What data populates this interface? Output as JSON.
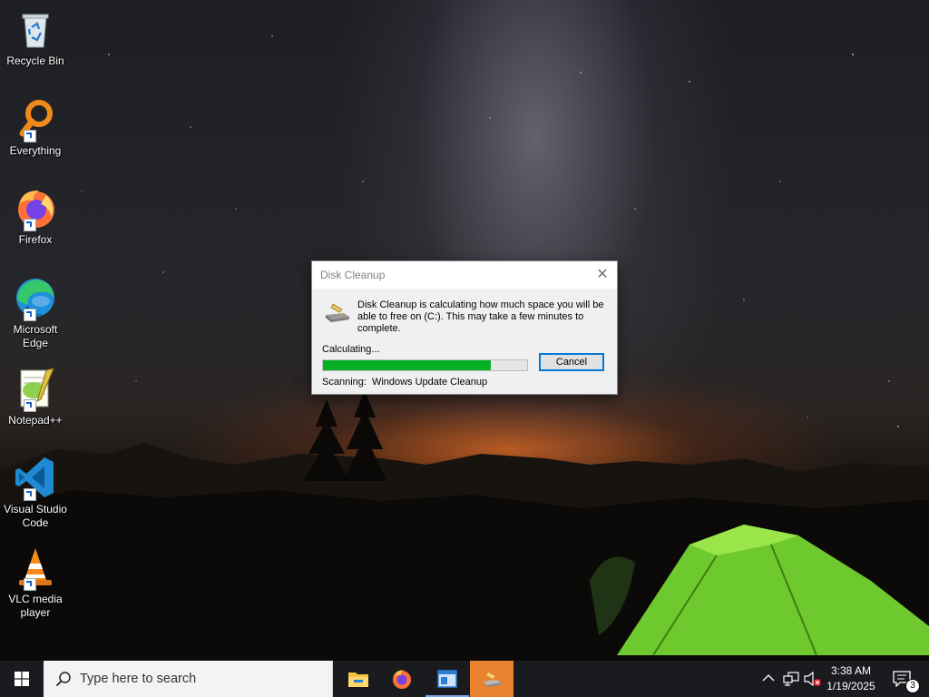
{
  "desktop": {
    "icons": [
      {
        "label": "Recycle Bin",
        "icon": "recycle-bin-icon"
      },
      {
        "label": "Everything",
        "icon": "everything-search-icon"
      },
      {
        "label": "Firefox",
        "icon": "firefox-icon"
      },
      {
        "label": "Microsoft Edge",
        "icon": "edge-icon"
      },
      {
        "label": "Notepad++",
        "icon": "notepad-plus-plus-icon"
      },
      {
        "label": "Visual Studio Code",
        "icon": "vscode-icon"
      },
      {
        "label": "VLC media player",
        "icon": "vlc-icon"
      }
    ]
  },
  "dialog": {
    "title": "Disk Cleanup",
    "close_glyph": "✕",
    "message": "Disk Cleanup is calculating how much space you will be able to free on  (C:). This may take a few minutes to complete.",
    "status_label": "Calculating...",
    "progress_percent": 82,
    "cancel_label": "Cancel",
    "scanning_label": "Scanning:",
    "scanning_item": "Windows Update Cleanup"
  },
  "taskbar": {
    "search_placeholder": "Type here to search",
    "apps": [
      "file-explorer-icon",
      "firefox-icon",
      "window-app-icon",
      "disk-cleanup-icon"
    ],
    "clock_time": "3:38 AM",
    "clock_date": "1/19/2025",
    "notification_count": "3"
  },
  "colors": {
    "progress_fill": "#06b025",
    "accent": "#0078d7",
    "taskbar": "#1a1b1f",
    "active_app": "#e8822e"
  }
}
